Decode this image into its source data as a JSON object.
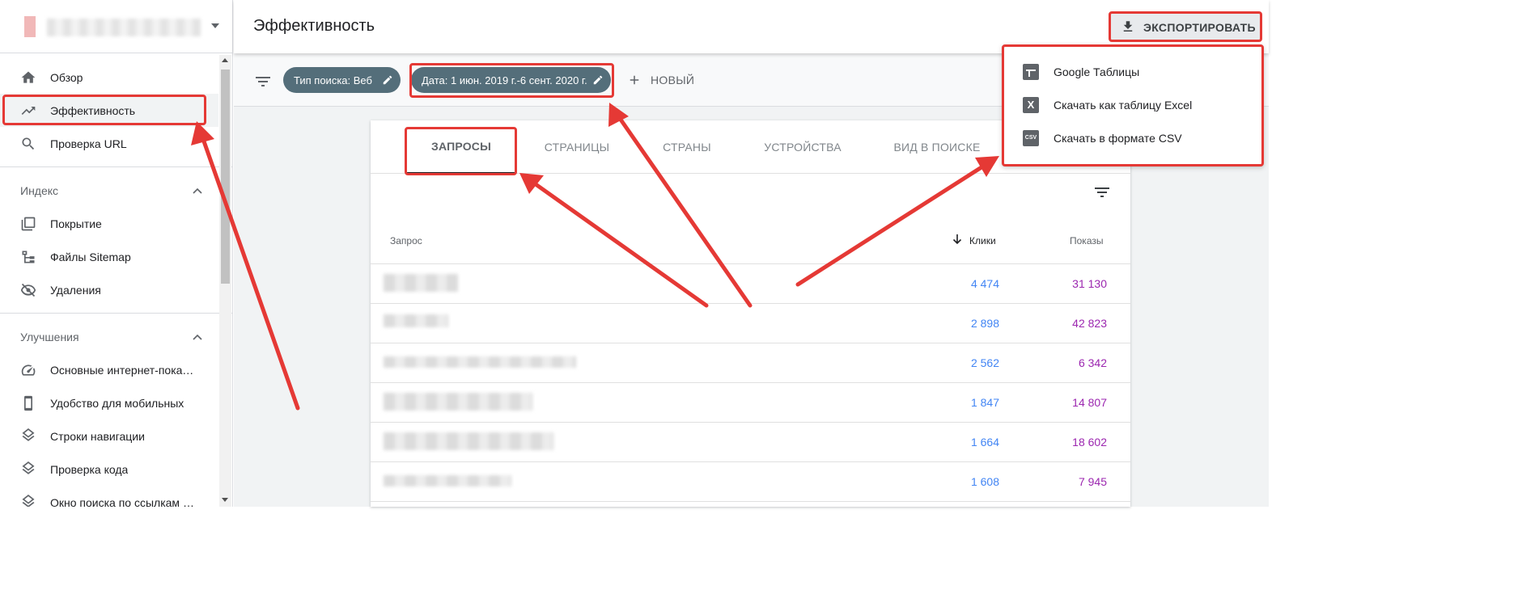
{
  "sidebar": {
    "property_name": "",
    "items_top": [
      {
        "label": "Обзор",
        "icon": "home-icon"
      },
      {
        "label": "Эффективность",
        "icon": "trending-up-icon",
        "active": true
      },
      {
        "label": "Проверка URL",
        "icon": "search-icon"
      }
    ],
    "section_index": {
      "title": "Индекс",
      "items": [
        {
          "label": "Покрытие",
          "icon": "pages-icon"
        },
        {
          "label": "Файлы Sitemap",
          "icon": "sitemap-icon"
        },
        {
          "label": "Удаления",
          "icon": "eye-off-icon"
        }
      ]
    },
    "section_improvements": {
      "title": "Улучшения",
      "items": [
        {
          "label": "Основные интернет-показатели",
          "icon": "speed-icon"
        },
        {
          "label": "Удобство для мобильных",
          "icon": "phone-icon"
        },
        {
          "label": "Строки навигации",
          "icon": "layers-icon"
        },
        {
          "label": "Проверка кода",
          "icon": "layers-icon"
        },
        {
          "label": "Окно поиска по ссылкам сайта",
          "icon": "layers-icon"
        }
      ]
    }
  },
  "header": {
    "title": "Эффективность",
    "export_label": "ЭКСПОРТИРОВАТЬ"
  },
  "filters": {
    "chip_search_type": "Тип поиска: Веб",
    "chip_date": "Дата: 1 июн. 2019 г.-6 сент. 2020 г.",
    "new_label": "НОВЫЙ"
  },
  "tabs": [
    {
      "label": "ЗАПРОСЫ",
      "active": true
    },
    {
      "label": "СТРАНИЦЫ"
    },
    {
      "label": "СТРАНЫ"
    },
    {
      "label": "УСТРОЙСТВА"
    },
    {
      "label": "ВИД В ПОИСКЕ"
    }
  ],
  "table": {
    "columns": {
      "query": "Запрос",
      "clicks": "Клики",
      "impressions": "Показы"
    },
    "rows": [
      {
        "query": "",
        "clicks": "4 474",
        "impressions": "31 130"
      },
      {
        "query": "",
        "clicks": "2 898",
        "impressions": "42 823"
      },
      {
        "query": "",
        "clicks": "2 562",
        "impressions": "6 342"
      },
      {
        "query": "",
        "clicks": "1 847",
        "impressions": "14 807"
      },
      {
        "query": "",
        "clicks": "1 664",
        "impressions": "18 602"
      },
      {
        "query": "",
        "clicks": "1 608",
        "impressions": "7 945"
      }
    ]
  },
  "export_menu": [
    {
      "label": "Google Таблицы",
      "icon": "google-sheets-icon"
    },
    {
      "label": "Скачать как таблицу Excel",
      "icon": "excel-icon"
    },
    {
      "label": "Скачать в формате CSV",
      "icon": "csv-icon"
    }
  ],
  "colors": {
    "chip": "#546e7a",
    "clicks": "#4285f4",
    "impressions": "#9c27b0",
    "annotation": "#e53935"
  }
}
